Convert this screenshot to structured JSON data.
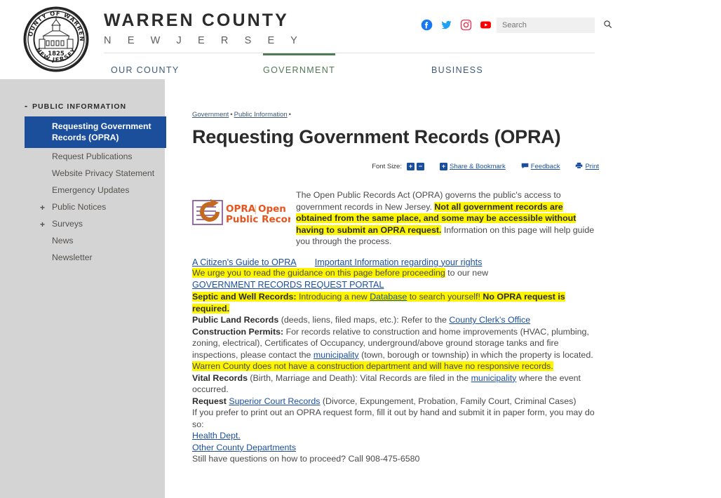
{
  "header": {
    "seal_alt": "County of Warren New Jersey 1825 seal",
    "brand_line1": "WARREN COUNTY",
    "brand_line2": "N E W    J E R S E Y",
    "socials": [
      {
        "name": "facebook-icon",
        "label": "Facebook",
        "color": "#1877f2"
      },
      {
        "name": "twitter-icon",
        "label": "Twitter",
        "color": "#1da1f2"
      },
      {
        "name": "instagram-icon",
        "label": "Instagram",
        "color": "#e4405f"
      },
      {
        "name": "youtube-icon",
        "label": "YouTube",
        "color": "#ff0000"
      }
    ],
    "search": {
      "placeholder": "Search",
      "value": "",
      "button_icon": "search-icon"
    }
  },
  "mainnav": {
    "items": [
      {
        "label": "OUR COUNTY",
        "active": false
      },
      {
        "label": "GOVERNMENT",
        "active": true
      },
      {
        "label": "BUSINESS",
        "active": false
      }
    ],
    "active_color": "#4f7a53",
    "inactive_color": "#3e5a78"
  },
  "sidebar": {
    "section_title": "PUBLIC INFORMATION",
    "toggle_glyph": "-",
    "active_color": "#1b4f9c",
    "background": "#d4d4d4",
    "items": [
      {
        "label": "Requesting Government Records (OPRA)",
        "active": true,
        "expandable": false
      },
      {
        "label": "Request Publications",
        "active": false,
        "expandable": false
      },
      {
        "label": "Website Privacy Statement",
        "active": false,
        "expandable": false
      },
      {
        "label": "Emergency Updates",
        "active": false,
        "expandable": false
      },
      {
        "label": "Public Notices",
        "active": false,
        "expandable": true,
        "glyph": "+"
      },
      {
        "label": "Surveys",
        "active": false,
        "expandable": true,
        "glyph": "+"
      },
      {
        "label": "News",
        "active": false,
        "expandable": false
      },
      {
        "label": "Newsletter",
        "active": false,
        "expandable": false
      }
    ]
  },
  "breadcrumb": {
    "items": [
      "Government",
      "Public Information"
    ],
    "separator": "•"
  },
  "page_title": "Requesting Government Records (OPRA)",
  "toolbar": {
    "font_size_label": "Font Size:",
    "increase_glyph": "+",
    "decrease_glyph": "−",
    "share_plus_glyph": "+",
    "share_label": "Share & Bookmark",
    "feedback_icon": "comment-icon",
    "feedback_label": "Feedback",
    "print_icon": "printer-icon",
    "print_label": "Print"
  },
  "content": {
    "opra_logo": {
      "name": "opra-logo",
      "text_line1_a": "OPRA",
      "text_line1_sep": "|",
      "text_line1_b": "Open",
      "text_line2": "Public RecordsAct",
      "accent": "#e8541e",
      "arrow_color": "#7b4a8c"
    },
    "intro": {
      "part1": "The Open Public Records Act (OPRA) governs the public's access to government records in New Jersey. ",
      "highlight": "Not all government records are obtained from the same place, and some may be accessible without having to submit an OPRA request.",
      "part2": " Information on this page will help guide you through the process."
    },
    "quick_links": [
      {
        "label": "A Citizen's Guide to OPRA"
      },
      {
        "label": "Important Information regarding your rights "
      }
    ],
    "urge": {
      "highlight": "We urge you to read the guidance on this page before proceeding",
      "tail": " to our new"
    },
    "portal_link": "GOVERNMENT RECORDS REQUEST PORTAL",
    "septic": {
      "lead": "Septic and Well Records:",
      "mid": " Introducing a new ",
      "link": "Database",
      "after": " to search yourself! ",
      "bold_tail": "No OPRA request is required."
    },
    "public_land": {
      "lead": "Public Land Records",
      "mid": " (deeds, liens, filed maps, etc.): Refer to the ",
      "link": "County Clerk's Office"
    },
    "construction": {
      "lead": "Construction Permits:",
      "body1": " For records relative to construction and home improvements (HVAC, plumbing, zoning, electrical), Certificates of Occupancy, underground/above ground storage tanks and fire inspections, please contact the ",
      "link": "municipality",
      "body2": " (town, borough or township) in which the property is located. ",
      "highlight": "Warren County does not have a construction department and will have no responsive records."
    },
    "vital": {
      "lead": "Vital Records",
      "body1": " (Birth, Marriage and Death): Vital Records are filed in the ",
      "link": "municipality",
      "body2": " where the event occurred."
    },
    "superior": {
      "lead": "Request ",
      "link": "Superior Court Records",
      "tail": " (Divorce, Expungement, Probation, Family Court, Criminal Cases)"
    },
    "print_form": {
      "text": "If you prefer to print out an OPRA request form, fill it out by hand and submit it in paper form, you may do so:",
      "links": [
        "Health Dept. ",
        "Other County Departments"
      ]
    },
    "questions": "Still have questions on how to proceed? Call 908-475-6580"
  }
}
